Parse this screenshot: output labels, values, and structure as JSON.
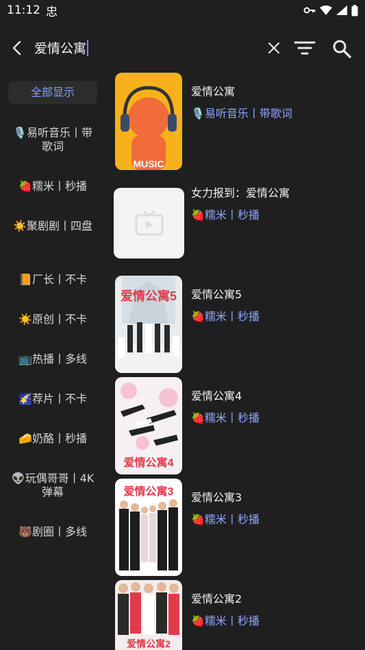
{
  "status": {
    "time": "11:12",
    "carrier_glyph": "忠"
  },
  "search": {
    "query": "爱情公寓"
  },
  "sidebar": {
    "items": [
      {
        "label": "全部显示",
        "active": true
      },
      {
        "label": "🎙️易听音乐丨带歌词"
      },
      {
        "label": "🍓糯米丨秒播"
      },
      {
        "label": "☀️聚剧剧丨四盘"
      },
      {
        "label": "📙厂长丨不卡"
      },
      {
        "label": "☀️原创丨不卡"
      },
      {
        "label": "📺热播丨多线"
      },
      {
        "label": "🌠荐片丨不卡"
      },
      {
        "label": "🧀奶酪丨秒播"
      },
      {
        "label": "👽玩偶哥哥丨4K弹幕"
      },
      {
        "label": "🐻剧圈丨多线"
      }
    ]
  },
  "results": [
    {
      "title": "爱情公寓",
      "source": "🎙️易听音乐丨带歌词",
      "poster_text": "MUSIC"
    },
    {
      "title": "女力报到：爱情公寓",
      "source": "🍓糯米丨秒播"
    },
    {
      "title": "爱情公寓5",
      "source": "🍓糯米丨秒播",
      "poster_text": "爱情公寓5"
    },
    {
      "title": "爱情公寓4",
      "source": "🍓糯米丨秒播",
      "poster_text": "爱情公寓4"
    },
    {
      "title": "爱情公寓3",
      "source": "🍓糯米丨秒播",
      "poster_text": "爱情公寓3"
    },
    {
      "title": "爱情公寓2",
      "source": "🍓糯米丨秒播",
      "poster_text": "爱情公寓2"
    }
  ],
  "colors": {
    "accent": "#7ea0ff",
    "background": "#1f1f1f",
    "poster1_bg": "#f7b21b",
    "poster_red": "#e33a4a"
  }
}
